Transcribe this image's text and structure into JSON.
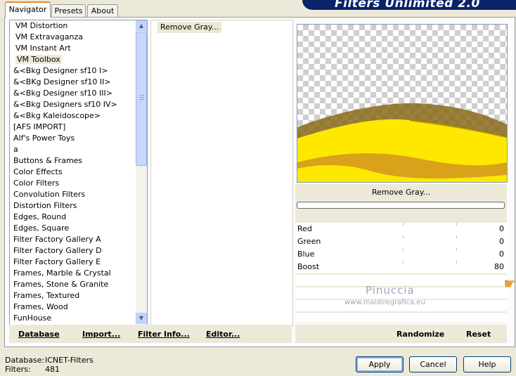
{
  "tabs": [
    "Navigator",
    "Presets",
    "About"
  ],
  "brand_title": "Filters Unlimited 2.0",
  "categories": [
    "VM Distortion",
    "VM Extravaganza",
    "VM Instant Art",
    "VM Toolbox",
    "&<Bkg Designer sf10 I>",
    "&<BKg Designer sf10 II>",
    "&<Bkg Designer sf10 III>",
    "&<Bkg Designers sf10 IV>",
    "&<Bkg Kaleidoscope>",
    "[AFS IMPORT]",
    "Alf's Power Toys",
    "a",
    "Buttons & Frames",
    "Color Effects",
    "Color Filters",
    "Convolution Filters",
    "Distortion Filters",
    "Edges, Round",
    "Edges, Square",
    "Filter Factory Gallery A",
    "Filter Factory Gallery D",
    "Filter Factory Gallery E",
    "Frames, Marble & Crystal",
    "Frames, Stone & Granite",
    "Frames, Textured",
    "Frames, Wood",
    "FunHouse"
  ],
  "selected_category": "VM Toolbox",
  "filters": [
    "Remove Gray..."
  ],
  "filter_name": "Remove Gray...",
  "params": [
    {
      "label": "Red",
      "value": "0"
    },
    {
      "label": "Green",
      "value": "0"
    },
    {
      "label": "Blue",
      "value": "0"
    },
    {
      "label": "Boost",
      "value": "80"
    }
  ],
  "watermark": {
    "name": "Pinuccia",
    "url": "www.maidiregrafica.eu"
  },
  "toolbar": {
    "database": "Database",
    "import": "Import...",
    "filter_info": "Filter Info...",
    "editor": "Editor..."
  },
  "toolbar2": {
    "randomize": "Randomize",
    "reset": "Reset"
  },
  "status": {
    "database_label": "Database:",
    "database_value": "ICNET-Filters",
    "filters_label": "Filters:",
    "filters_value": "481"
  },
  "buttons": {
    "apply": "Apply",
    "cancel": "Cancel",
    "help": "Help"
  },
  "colors": {
    "wave_yellow": "#ffe800",
    "wave_shadow": "#8a6a1a",
    "accent_tab": "#e68b2c"
  }
}
